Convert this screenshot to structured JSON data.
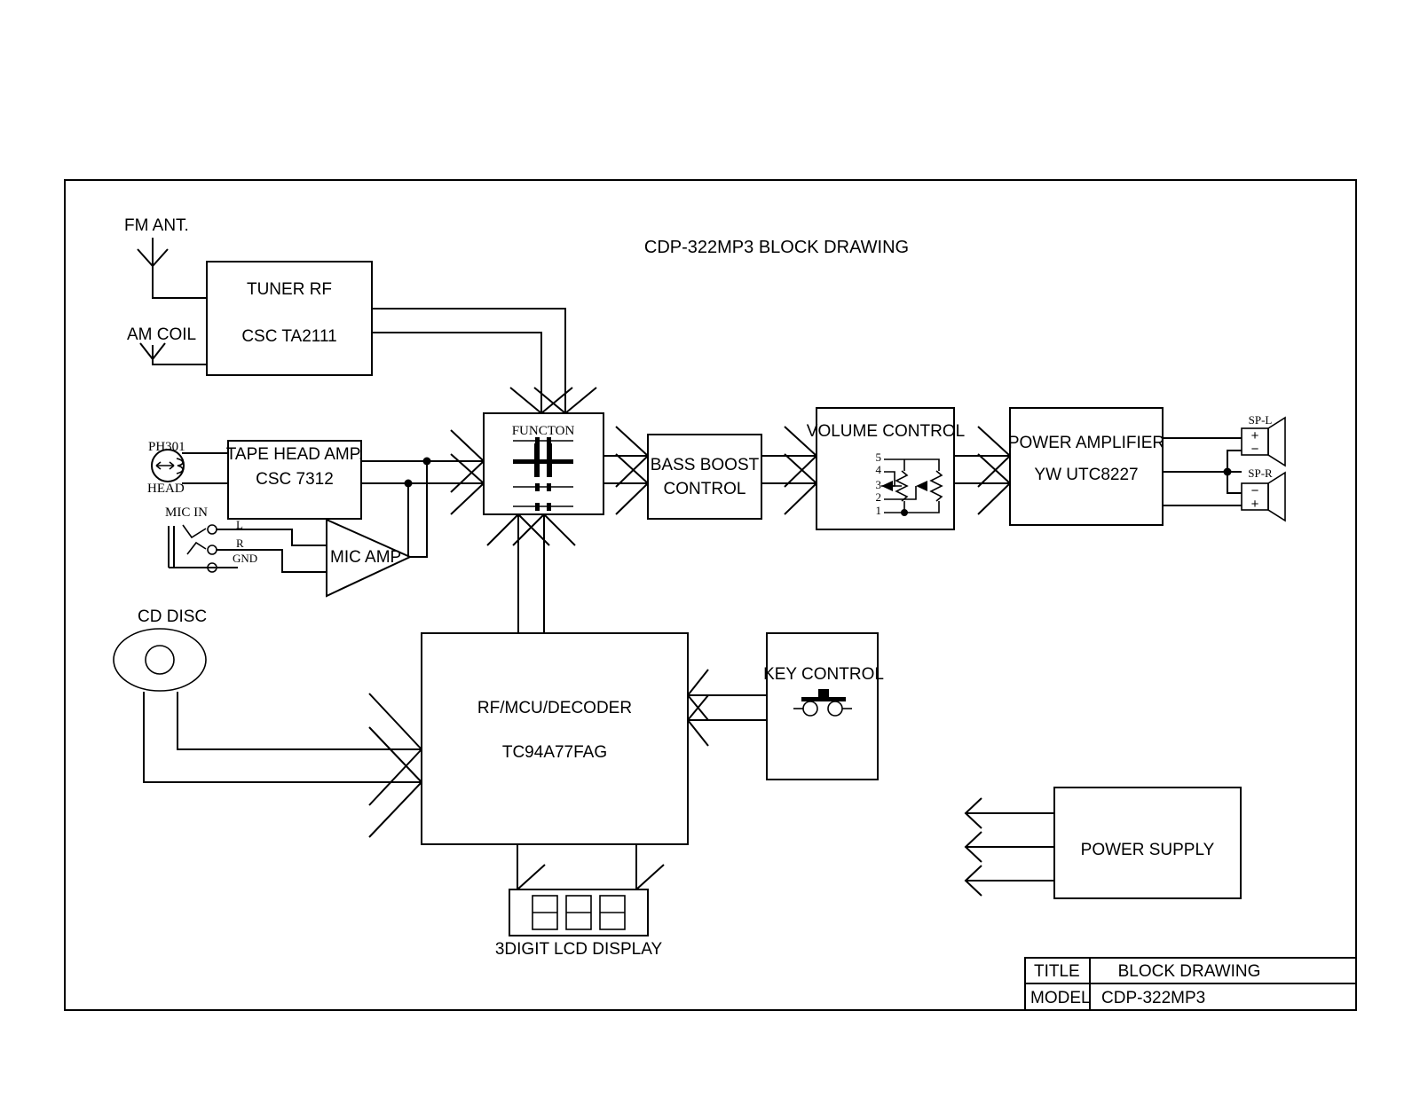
{
  "drawing": {
    "title": "CDP-322MP3 BLOCK DRAWING",
    "frame_color": "#000000",
    "background": "#ffffff"
  },
  "inputs": {
    "fm_ant": "FM ANT.",
    "am_coil": "AM COIL",
    "ph301": "PH301",
    "head": "HEAD",
    "mic_in": "MIC IN",
    "mic_l": "L",
    "mic_r": "R",
    "mic_gnd": "GND",
    "cd_disc": "CD DISC"
  },
  "blocks": {
    "tuner": {
      "line1": "TUNER RF",
      "line2": "CSC TA2111"
    },
    "tape_head_amp": {
      "line1": "TAPE HEAD AMP.",
      "line2": "CSC 7312"
    },
    "mic_amp": {
      "label": "MIC AMP"
    },
    "function_switch": {
      "label": "FUNCTON"
    },
    "bass_boost": {
      "line1": "BASS BOOST",
      "line2": "CONTROL"
    },
    "volume_control": {
      "label": "VOLUME CONTROL",
      "pins": [
        "5",
        "4",
        "3",
        "2",
        "1"
      ]
    },
    "power_amplifier": {
      "line1": "POWER AMPLIFIER",
      "line2": "YW UTC8227"
    },
    "rf_mcu_decoder": {
      "line1": "RF/MCU/DECODER",
      "line2": "TC94A77FAG"
    },
    "key_control": {
      "label": "KEY CONTROL"
    },
    "lcd_display": {
      "label": "3DIGIT LCD DISPLAY",
      "digits": 3
    },
    "power_supply": {
      "label": "POWER SUPPLY",
      "rails": 3
    }
  },
  "outputs": {
    "speaker_left": {
      "label": "SP-L",
      "top_terminal": "+",
      "bottom_terminal": "−"
    },
    "speaker_right": {
      "label": "SP-R",
      "top_terminal": "−",
      "bottom_terminal": "+"
    }
  },
  "title_block": {
    "rows": [
      {
        "key": "TITLE",
        "value": "BLOCK DRAWING"
      },
      {
        "key": "MODEL",
        "value": "CDP-322MP3"
      }
    ]
  }
}
